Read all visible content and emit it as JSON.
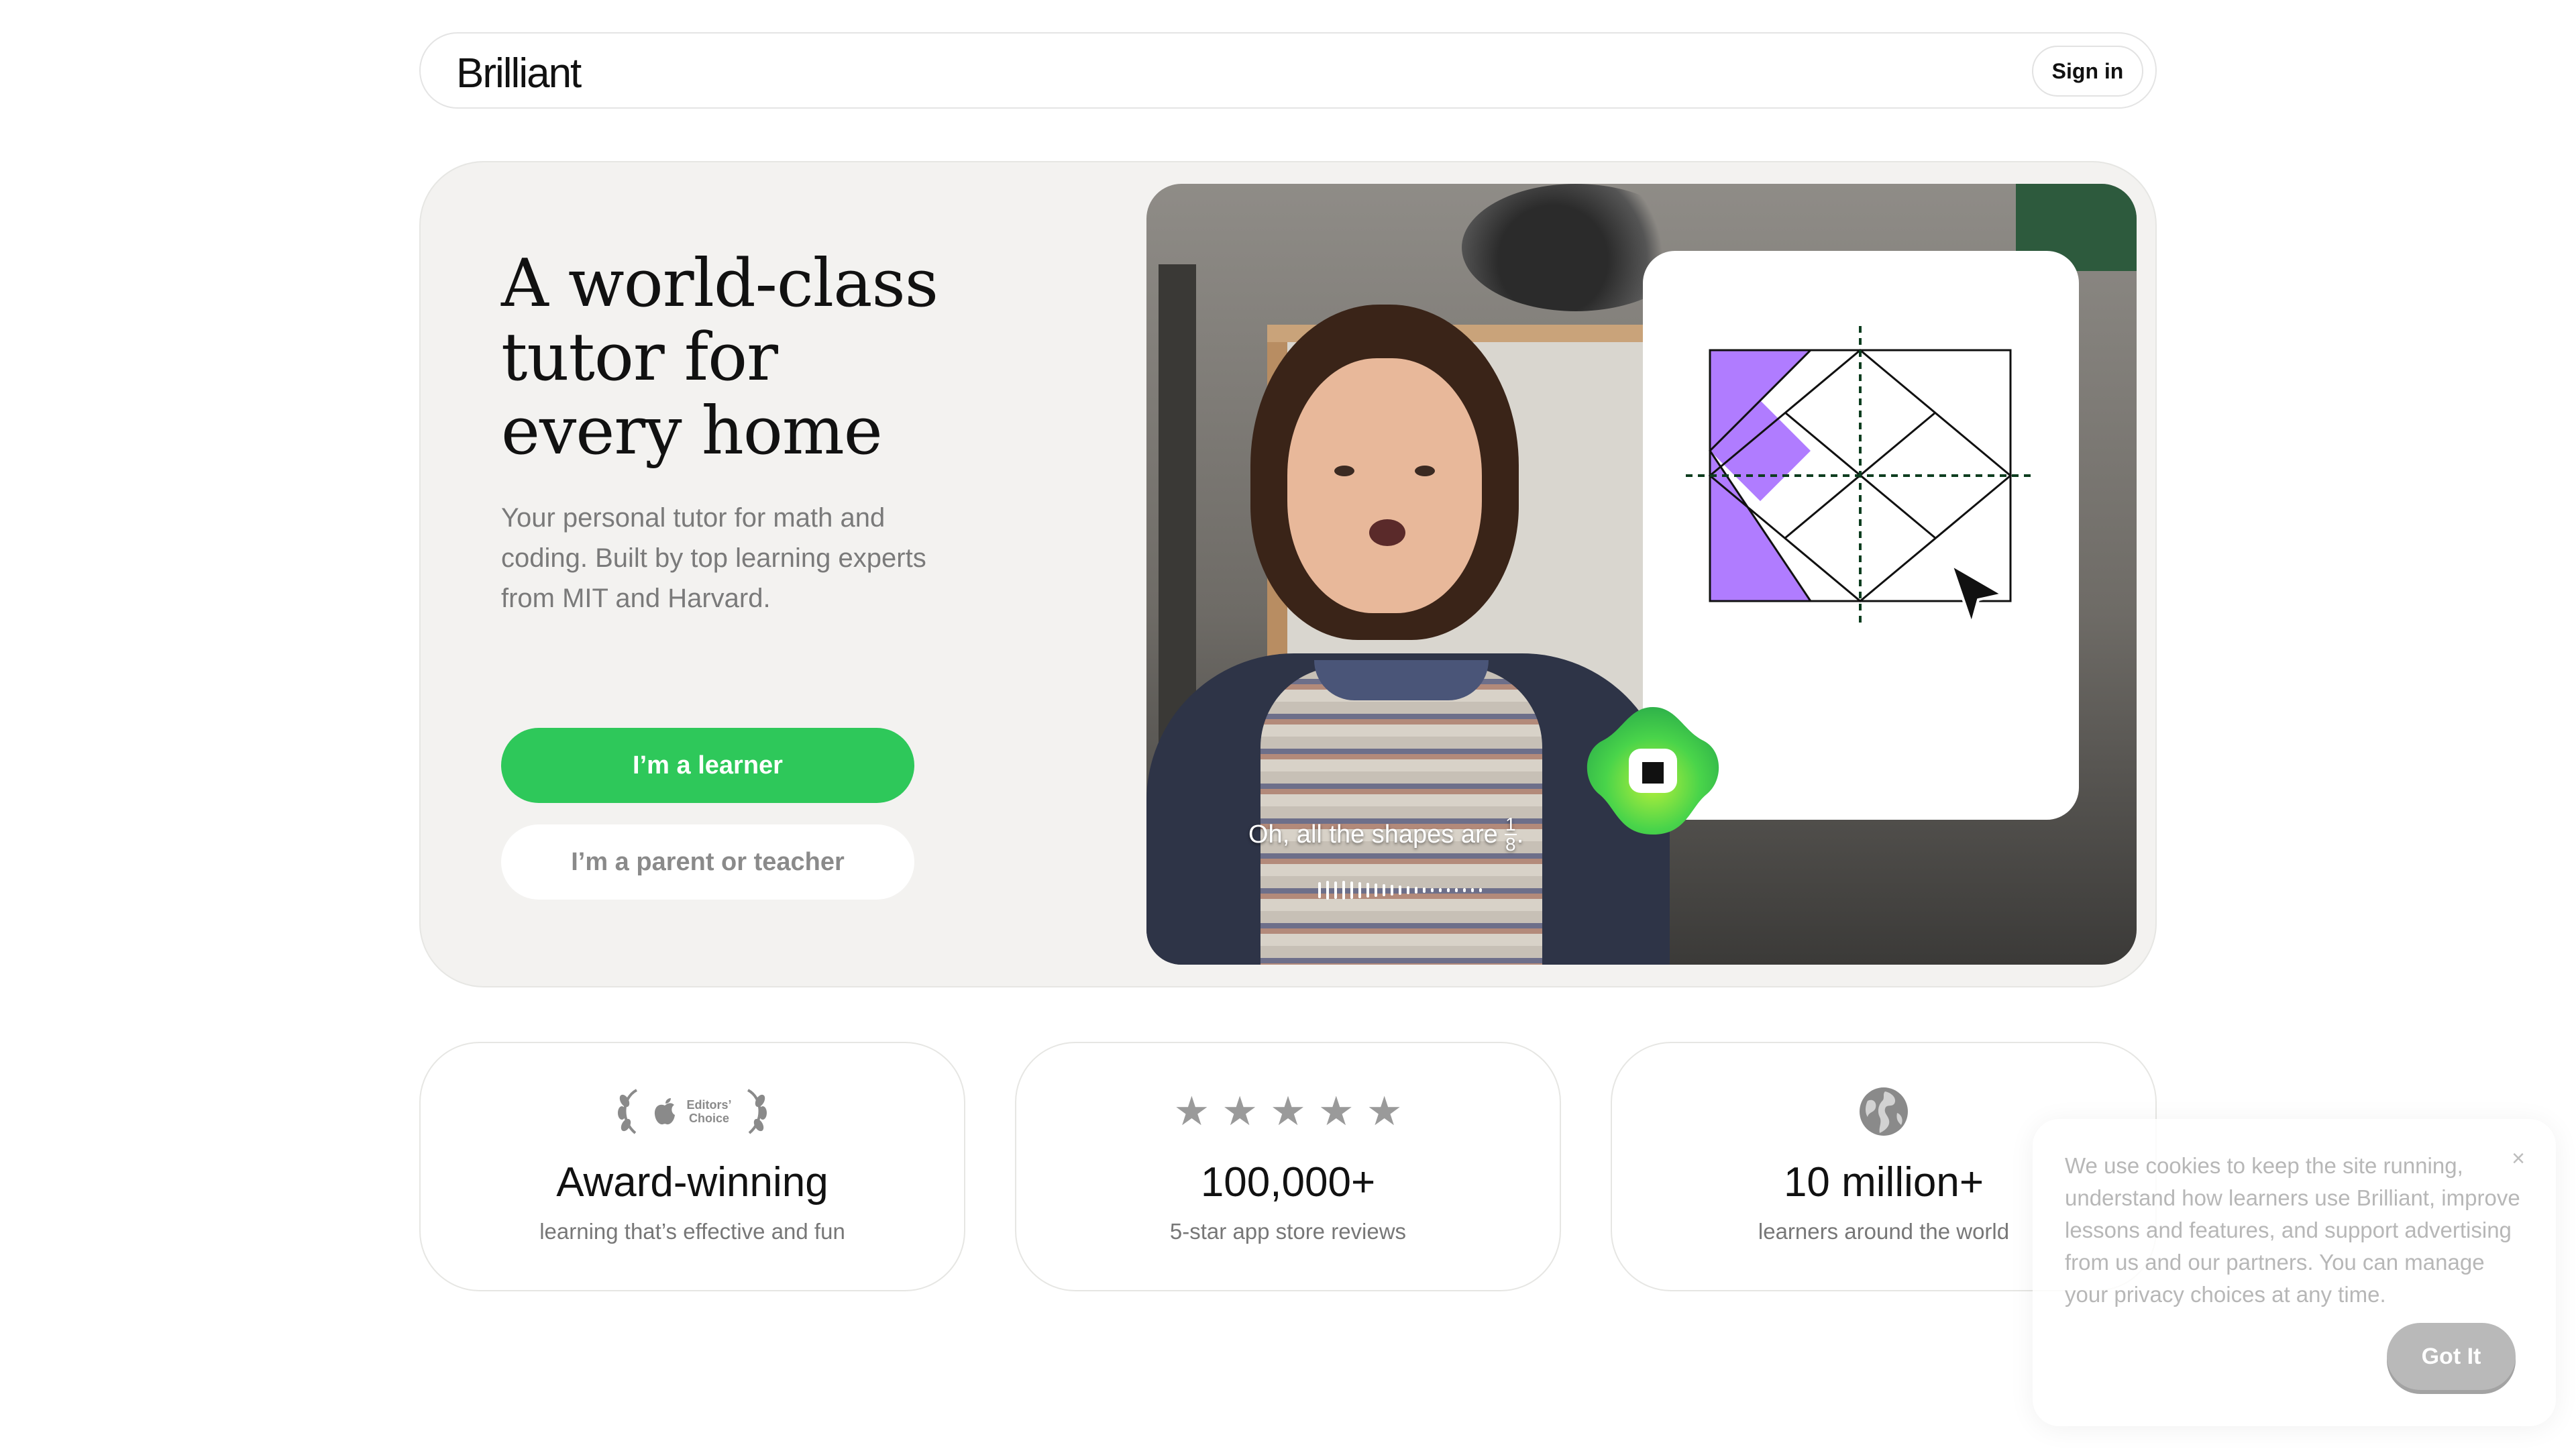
{
  "header": {
    "logo": "Brilliant",
    "signin_label": "Sign in"
  },
  "hero": {
    "title_line1": "A world-class",
    "title_line2": "tutor for",
    "title_line3": "every home",
    "subtitle": "Your personal tutor for math and coding. Built by top learning experts from MIT and Harvard.",
    "learner_button": "I’m a learner",
    "parent_button": "I’m a parent or teacher"
  },
  "video": {
    "caption_text": "Oh, all the shapes are",
    "caption_fraction_num": "1",
    "caption_fraction_den": "8",
    "caption_period": "."
  },
  "stats": [
    {
      "icon": "editors-choice-laurel-icon",
      "badge_line1": "Editors’",
      "badge_line2": "Choice",
      "title": "Award-winning",
      "subtitle": "learning that’s effective and fun"
    },
    {
      "icon": "five-stars-icon",
      "stars": 5,
      "title": "100,000+",
      "subtitle": "5-star app store reviews"
    },
    {
      "icon": "globe-icon",
      "title": "10 million+",
      "subtitle": "learners around the world"
    }
  ],
  "cookie": {
    "text": "We use cookies to keep the site running, understand how learners use Brilliant, improve lessons and features, and support advertising from us and our partners. You can manage your privacy choices at any time.",
    "button_label": "Got It",
    "close_symbol": "×"
  },
  "colors": {
    "accent_green": "#2ec85a",
    "puzzle_purple": "#b07cff"
  }
}
